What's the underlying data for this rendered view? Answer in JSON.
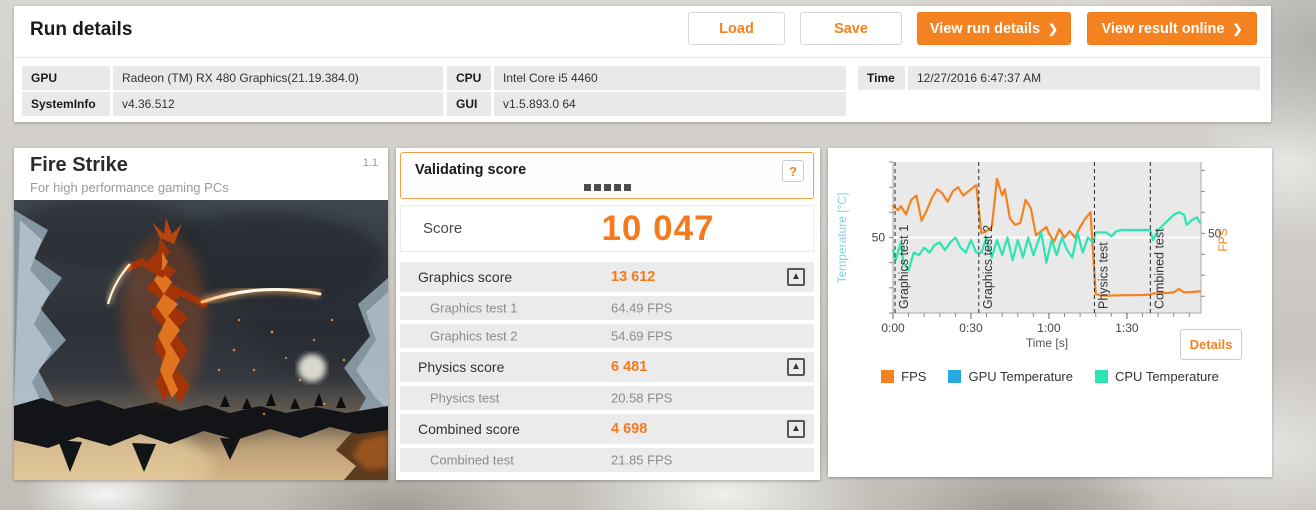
{
  "header": {
    "title": "Run details",
    "load_label": "Load",
    "save_label": "Save",
    "view_run_label": "View run details",
    "view_online_label": "View result online"
  },
  "icons": {
    "chevron_right": "❯",
    "collapse_arrow": "▲",
    "help": "?"
  },
  "info": {
    "rows": [
      {
        "label": "GPU",
        "value": "Radeon (TM) RX 480 Graphics(21.19.384.0)"
      },
      {
        "label": "SystemInfo",
        "value": "v4.36.512"
      },
      {
        "label": "CPU",
        "value": "Intel Core i5 4460"
      },
      {
        "label": "GUI",
        "value": "v1.5.893.0 64"
      },
      {
        "label": "Time",
        "value": "12/27/2016 6:47:37 AM"
      }
    ]
  },
  "benchmark": {
    "name": "Fire Strike",
    "tagline": "For high performance gaming PCs",
    "version": "1.1"
  },
  "score_panel": {
    "validating_label": "Validating score",
    "score_label": "Score",
    "score_value": "10 047",
    "rows": [
      {
        "type": "score",
        "label": "Graphics score",
        "value": "13 612"
      },
      {
        "type": "sub",
        "label": "Graphics test 1",
        "value": "64.49 FPS"
      },
      {
        "type": "sub",
        "label": "Graphics test 2",
        "value": "54.69 FPS"
      },
      {
        "type": "score",
        "label": "Physics score",
        "value": "6 481"
      },
      {
        "type": "sub",
        "label": "Physics test",
        "value": "20.58 FPS"
      },
      {
        "type": "score",
        "label": "Combined score",
        "value": "4 698"
      },
      {
        "type": "sub",
        "label": "Combined test",
        "value": "21.85 FPS"
      }
    ]
  },
  "chart": {
    "details_label": "Details"
  },
  "legend": [
    {
      "label": "FPS",
      "color": "#f58220"
    },
    {
      "label": "GPU Temperature",
      "color": "#29a9e1"
    },
    {
      "label": "CPU Temperature",
      "color": "#2ce5b2"
    }
  ],
  "chart_data": {
    "type": "line",
    "xlabel": "Time [s]",
    "x_range": [
      0,
      118.5
    ],
    "x_ticks": [
      {
        "t": 0,
        "label": "0:00"
      },
      {
        "t": 30,
        "label": "0:30"
      },
      {
        "t": 60,
        "label": "1:00"
      },
      {
        "t": 90,
        "label": "1:30"
      }
    ],
    "left_axis": {
      "label": "Temperature [°C]",
      "color": "#85cfe8",
      "label_value": 50,
      "range": [
        20,
        80
      ]
    },
    "right_axis": {
      "label": "FPS",
      "color": "#f58220",
      "label_value": 50,
      "range": [
        12,
        84
      ]
    },
    "grid": "single horizontal line at 50",
    "sections": [
      {
        "label": "Graphics test 1",
        "start": 0.5
      },
      {
        "label": "Graphics test 2",
        "start": 33
      },
      {
        "label": "Physics test",
        "start": 77.5
      },
      {
        "label": "Combined test",
        "start": 99
      }
    ],
    "series": [
      {
        "name": "FPS",
        "color": "#f58220",
        "axis": "right",
        "points": [
          [
            0,
            63
          ],
          [
            2,
            61
          ],
          [
            3,
            63
          ],
          [
            5,
            59
          ],
          [
            7,
            66
          ],
          [
            9,
            68
          ],
          [
            11,
            56
          ],
          [
            13,
            61
          ],
          [
            15,
            67
          ],
          [
            17,
            71
          ],
          [
            19,
            69
          ],
          [
            21,
            65
          ],
          [
            23,
            70
          ],
          [
            25,
            72
          ],
          [
            27,
            68
          ],
          [
            29,
            70
          ],
          [
            32,
            73
          ],
          [
            34,
            50
          ],
          [
            36,
            51
          ],
          [
            38,
            53
          ],
          [
            40,
            76
          ],
          [
            42,
            68
          ],
          [
            43,
            71
          ],
          [
            45,
            57
          ],
          [
            47,
            54
          ],
          [
            49,
            55
          ],
          [
            51,
            66
          ],
          [
            53,
            62
          ],
          [
            55,
            49
          ],
          [
            57,
            51
          ],
          [
            59,
            53
          ],
          [
            60,
            50
          ],
          [
            62,
            46
          ],
          [
            64,
            52
          ],
          [
            66,
            48
          ],
          [
            68,
            51
          ],
          [
            70,
            48
          ],
          [
            72,
            53
          ],
          [
            74,
            57
          ],
          [
            76,
            60
          ],
          [
            78,
            21
          ],
          [
            80,
            20.4
          ],
          [
            83,
            20.3
          ],
          [
            86,
            20.4
          ],
          [
            89,
            20.5
          ],
          [
            93,
            20.5
          ],
          [
            96,
            20.6
          ],
          [
            99,
            20.8
          ],
          [
            100,
            21.3
          ],
          [
            103,
            21.4
          ],
          [
            106,
            21.6
          ],
          [
            108,
            21.8
          ],
          [
            110,
            23.5
          ],
          [
            112,
            21.8
          ],
          [
            115,
            22
          ],
          [
            118,
            22.3
          ]
        ]
      },
      {
        "name": "GPU Temperature",
        "color": "#29a9e1",
        "axis": "left",
        "points": []
      },
      {
        "name": "CPU Temperature",
        "color": "#2ce5b2",
        "axis": "left",
        "points": [
          [
            0,
            45
          ],
          [
            1,
            41
          ],
          [
            3,
            48
          ],
          [
            4,
            40
          ],
          [
            6,
            37
          ],
          [
            8,
            44
          ],
          [
            10,
            43
          ],
          [
            12,
            46
          ],
          [
            14,
            44
          ],
          [
            16,
            47
          ],
          [
            18,
            48
          ],
          [
            20,
            45
          ],
          [
            22,
            48
          ],
          [
            24,
            50
          ],
          [
            26,
            46
          ],
          [
            28,
            44
          ],
          [
            30,
            49
          ],
          [
            32,
            44
          ],
          [
            34,
            44
          ],
          [
            36,
            50
          ],
          [
            38,
            42
          ],
          [
            40,
            49
          ],
          [
            42,
            43
          ],
          [
            44,
            50
          ],
          [
            46,
            41
          ],
          [
            48,
            49
          ],
          [
            50,
            42
          ],
          [
            52,
            50
          ],
          [
            54,
            43
          ],
          [
            55,
            46
          ],
          [
            57,
            52
          ],
          [
            59,
            40
          ],
          [
            61,
            49
          ],
          [
            63,
            43
          ],
          [
            65,
            50
          ],
          [
            67,
            45
          ],
          [
            69,
            42
          ],
          [
            71,
            52
          ],
          [
            73,
            44
          ],
          [
            75,
            50
          ],
          [
            77,
            48
          ],
          [
            78,
            52
          ],
          [
            80,
            52
          ],
          [
            82,
            52
          ],
          [
            84,
            50.5
          ],
          [
            86,
            52.5
          ],
          [
            88,
            53
          ],
          [
            91,
            53
          ],
          [
            94,
            53
          ],
          [
            97,
            53
          ],
          [
            99,
            53
          ],
          [
            100,
            49
          ],
          [
            102,
            53
          ],
          [
            104,
            55
          ],
          [
            106,
            57
          ],
          [
            108,
            59
          ],
          [
            110,
            60
          ],
          [
            112,
            59
          ],
          [
            113,
            55
          ],
          [
            115,
            57
          ],
          [
            117,
            58
          ],
          [
            118,
            56
          ]
        ]
      }
    ]
  }
}
